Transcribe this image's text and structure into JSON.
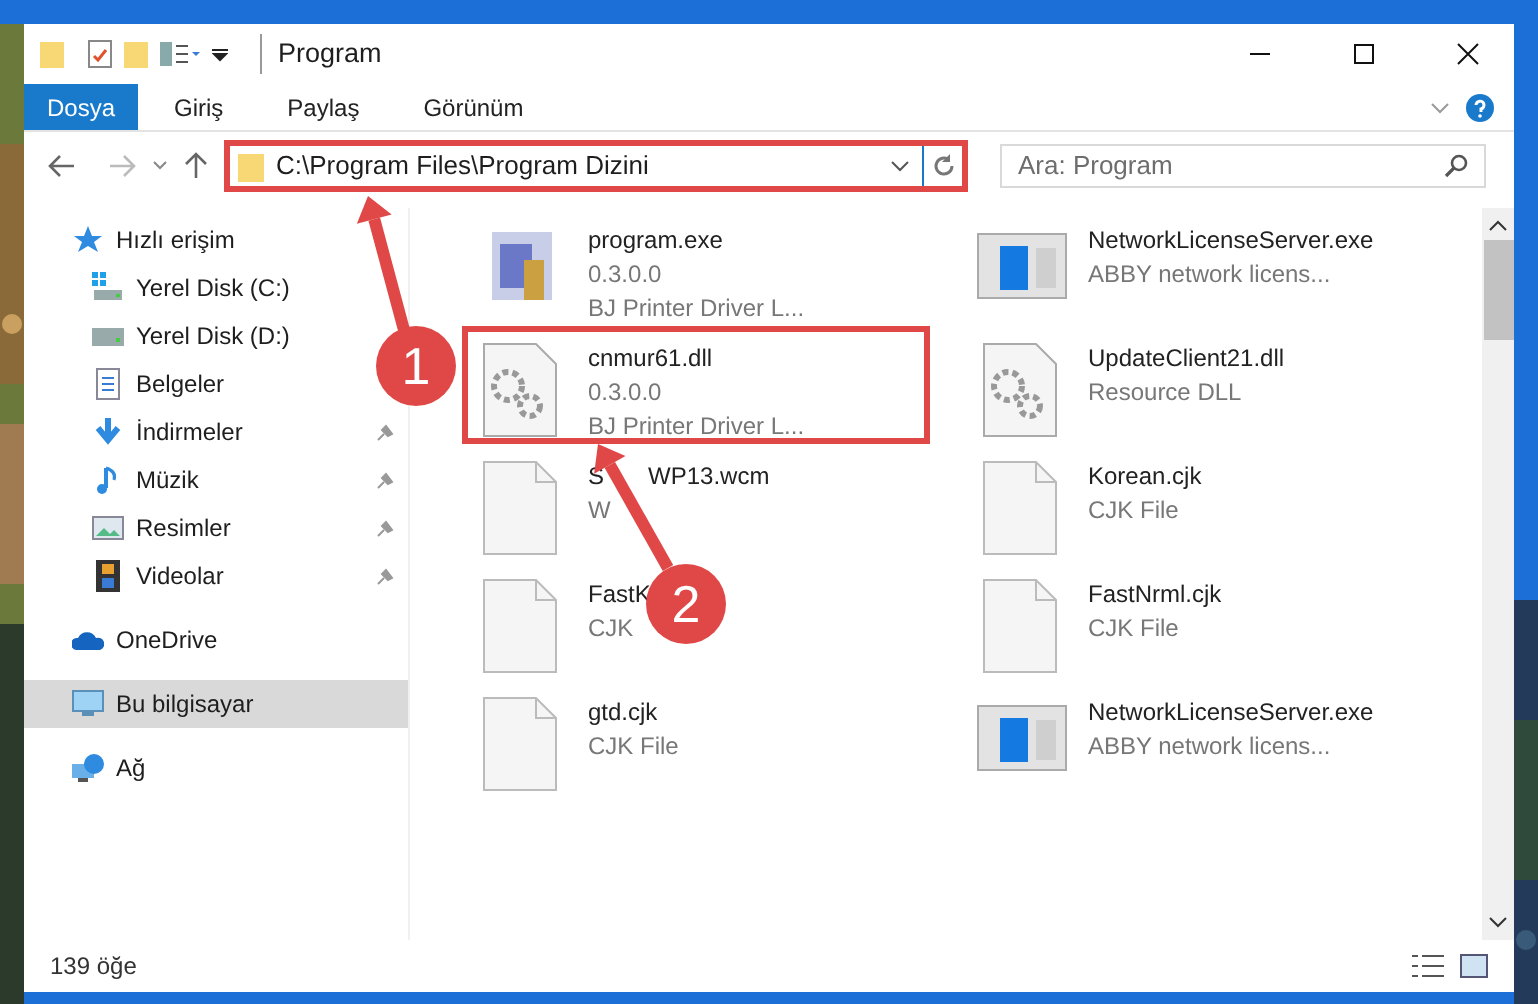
{
  "window": {
    "title": "Program"
  },
  "ribbon_tabs": [
    {
      "label": "Dosya",
      "selected": true
    },
    {
      "label": "Giriş",
      "selected": false
    },
    {
      "label": "Paylaş",
      "selected": false
    },
    {
      "label": "Görünüm",
      "selected": false
    }
  ],
  "address": {
    "path": "C:\\Program Files\\Program Dizini",
    "highlighted": true
  },
  "search": {
    "placeholder": "Ara: Program"
  },
  "sidebar": {
    "items": [
      {
        "label": "Hızlı erişim",
        "selected": false,
        "children": [
          {
            "label": "Yerel Disk (C:)",
            "pinned": false,
            "selected": false
          },
          {
            "label": "Yerel Disk (D:)",
            "pinned": false,
            "selected": false
          },
          {
            "label": "Belgeler",
            "pinned": false,
            "selected": false
          },
          {
            "label": "İndirmeler",
            "pinned": true,
            "selected": false
          },
          {
            "label": "Müzik",
            "pinned": true,
            "selected": false
          },
          {
            "label": "Resimler",
            "pinned": true,
            "selected": false
          },
          {
            "label": "Videolar",
            "pinned": true,
            "selected": false
          }
        ]
      },
      {
        "label": "OneDrive",
        "selected": false
      },
      {
        "label": "Bu bilgisayar",
        "selected": true
      },
      {
        "label": "Ağ",
        "selected": false
      }
    ]
  },
  "files": [
    {
      "kind": "setup",
      "name": "program.exe",
      "details": [
        "0.3.0.0",
        "BJ Printer Driver L..."
      ],
      "highlighted": false
    },
    {
      "kind": "app",
      "name": "NetworkLicenseServer.exe",
      "details": [
        "ABBY network licens..."
      ],
      "highlighted": false
    },
    {
      "kind": "dll",
      "name": "cnmur61.dll",
      "details": [
        "0.3.0.0",
        "BJ Printer Driver L..."
      ],
      "highlighted": true
    },
    {
      "kind": "dll",
      "name": "UpdateClient21.dll",
      "details": [
        "Resource DLL"
      ],
      "highlighted": false
    },
    {
      "kind": "file",
      "name_parts": [
        "S",
        "WP13.wcm"
      ],
      "details": [
        "W"
      ],
      "highlighted": false
    },
    {
      "kind": "file",
      "name": "Korean.cjk",
      "details": [
        "CJK File"
      ],
      "highlighted": false
    },
    {
      "kind": "file",
      "name": "FastK",
      "details": [
        "CJK"
      ],
      "highlighted": false
    },
    {
      "kind": "file",
      "name": "FastNrml.cjk",
      "details": [
        "CJK File"
      ],
      "highlighted": false
    },
    {
      "kind": "file",
      "name": "gtd.cjk",
      "details": [
        "CJK File"
      ],
      "highlighted": false
    },
    {
      "kind": "app",
      "name": "NetworkLicenseServer.exe",
      "details": [
        "ABBY network licens..."
      ],
      "highlighted": false
    }
  ],
  "callouts": [
    "1",
    "2"
  ],
  "status_bar": {
    "count": "139 öğe"
  }
}
